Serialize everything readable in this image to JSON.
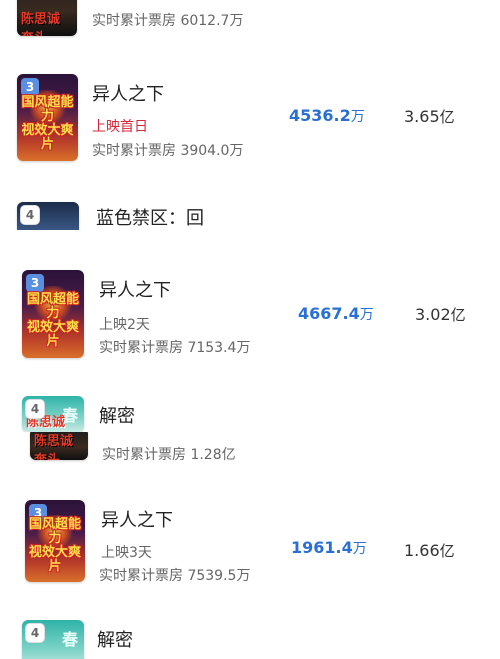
{
  "rows": [
    {
      "acc_label": "实时累计票房",
      "acc_value": "6012.7万",
      "poster_text": "陈思诚 奔头"
    },
    {
      "rank": "3",
      "title": "异人之下",
      "status": "上映首日",
      "acc_label": "实时累计票房",
      "acc_value": "3904.0万",
      "daily_num": "4536.2",
      "daily_unit": "万",
      "total_num": "3.65",
      "total_unit": "亿",
      "poster_tag": "国风超能力\n视效大爽片"
    },
    {
      "rank": "4",
      "title": "蓝色禁区：回"
    },
    {
      "rank": "3",
      "title": "异人之下",
      "status": "上映2天",
      "acc_label": "实时累计票房",
      "acc_value": "7153.4万",
      "daily_num": "4667.4",
      "daily_unit": "万",
      "total_num": "3.02",
      "total_unit": "亿",
      "poster_tag": "国风超能力\n视效大爽片"
    },
    {
      "rank": "4",
      "title": "解密",
      "poster_text": "陈思诚",
      "poster_mark": "春"
    },
    {
      "acc_label": "实时累计票房",
      "acc_value": "1.28亿",
      "poster_text": "陈思诚 奔头"
    },
    {
      "rank": "3",
      "title": "异人之下",
      "status": "上映3天",
      "acc_label": "实时累计票房",
      "acc_value": "7539.5万",
      "daily_num": "1961.4",
      "daily_unit": "万",
      "total_num": "1.66",
      "total_unit": "亿",
      "poster_tag": "国风超能力\n视效大爽片"
    },
    {
      "rank": "4",
      "title": "解密",
      "poster_mark": "春"
    }
  ]
}
